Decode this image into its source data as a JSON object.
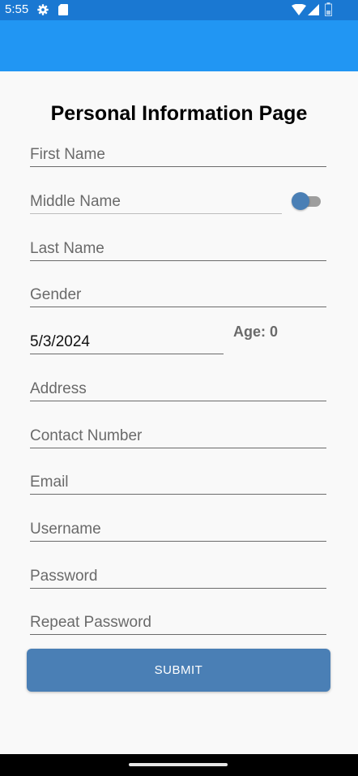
{
  "status_bar": {
    "time": "5:55",
    "icons": [
      "gear-icon",
      "sd-card-icon",
      "wifi-icon",
      "cell-signal-icon",
      "battery-icon"
    ],
    "color": "#1a78d2"
  },
  "app_bar": {
    "color": "#2196f3"
  },
  "page": {
    "title": "Personal Information Page"
  },
  "form": {
    "first_name_placeholder": "First Name",
    "middle_name_placeholder": "Middle Name",
    "middle_name_toggle": "off",
    "last_name_placeholder": "Last Name",
    "gender_placeholder": "Gender",
    "birth_date_value": "5/3/2024",
    "age_label": "Age: 0",
    "address_placeholder": "Address",
    "contact_number_placeholder": "Contact Number",
    "email_placeholder": "Email",
    "username_placeholder": "Username",
    "password_placeholder": "Password",
    "repeat_password_placeholder": "Repeat Password",
    "submit_label": "SUBMIT"
  },
  "colors": {
    "accent": "#4a7fb5",
    "background": "#f9f9f9"
  }
}
